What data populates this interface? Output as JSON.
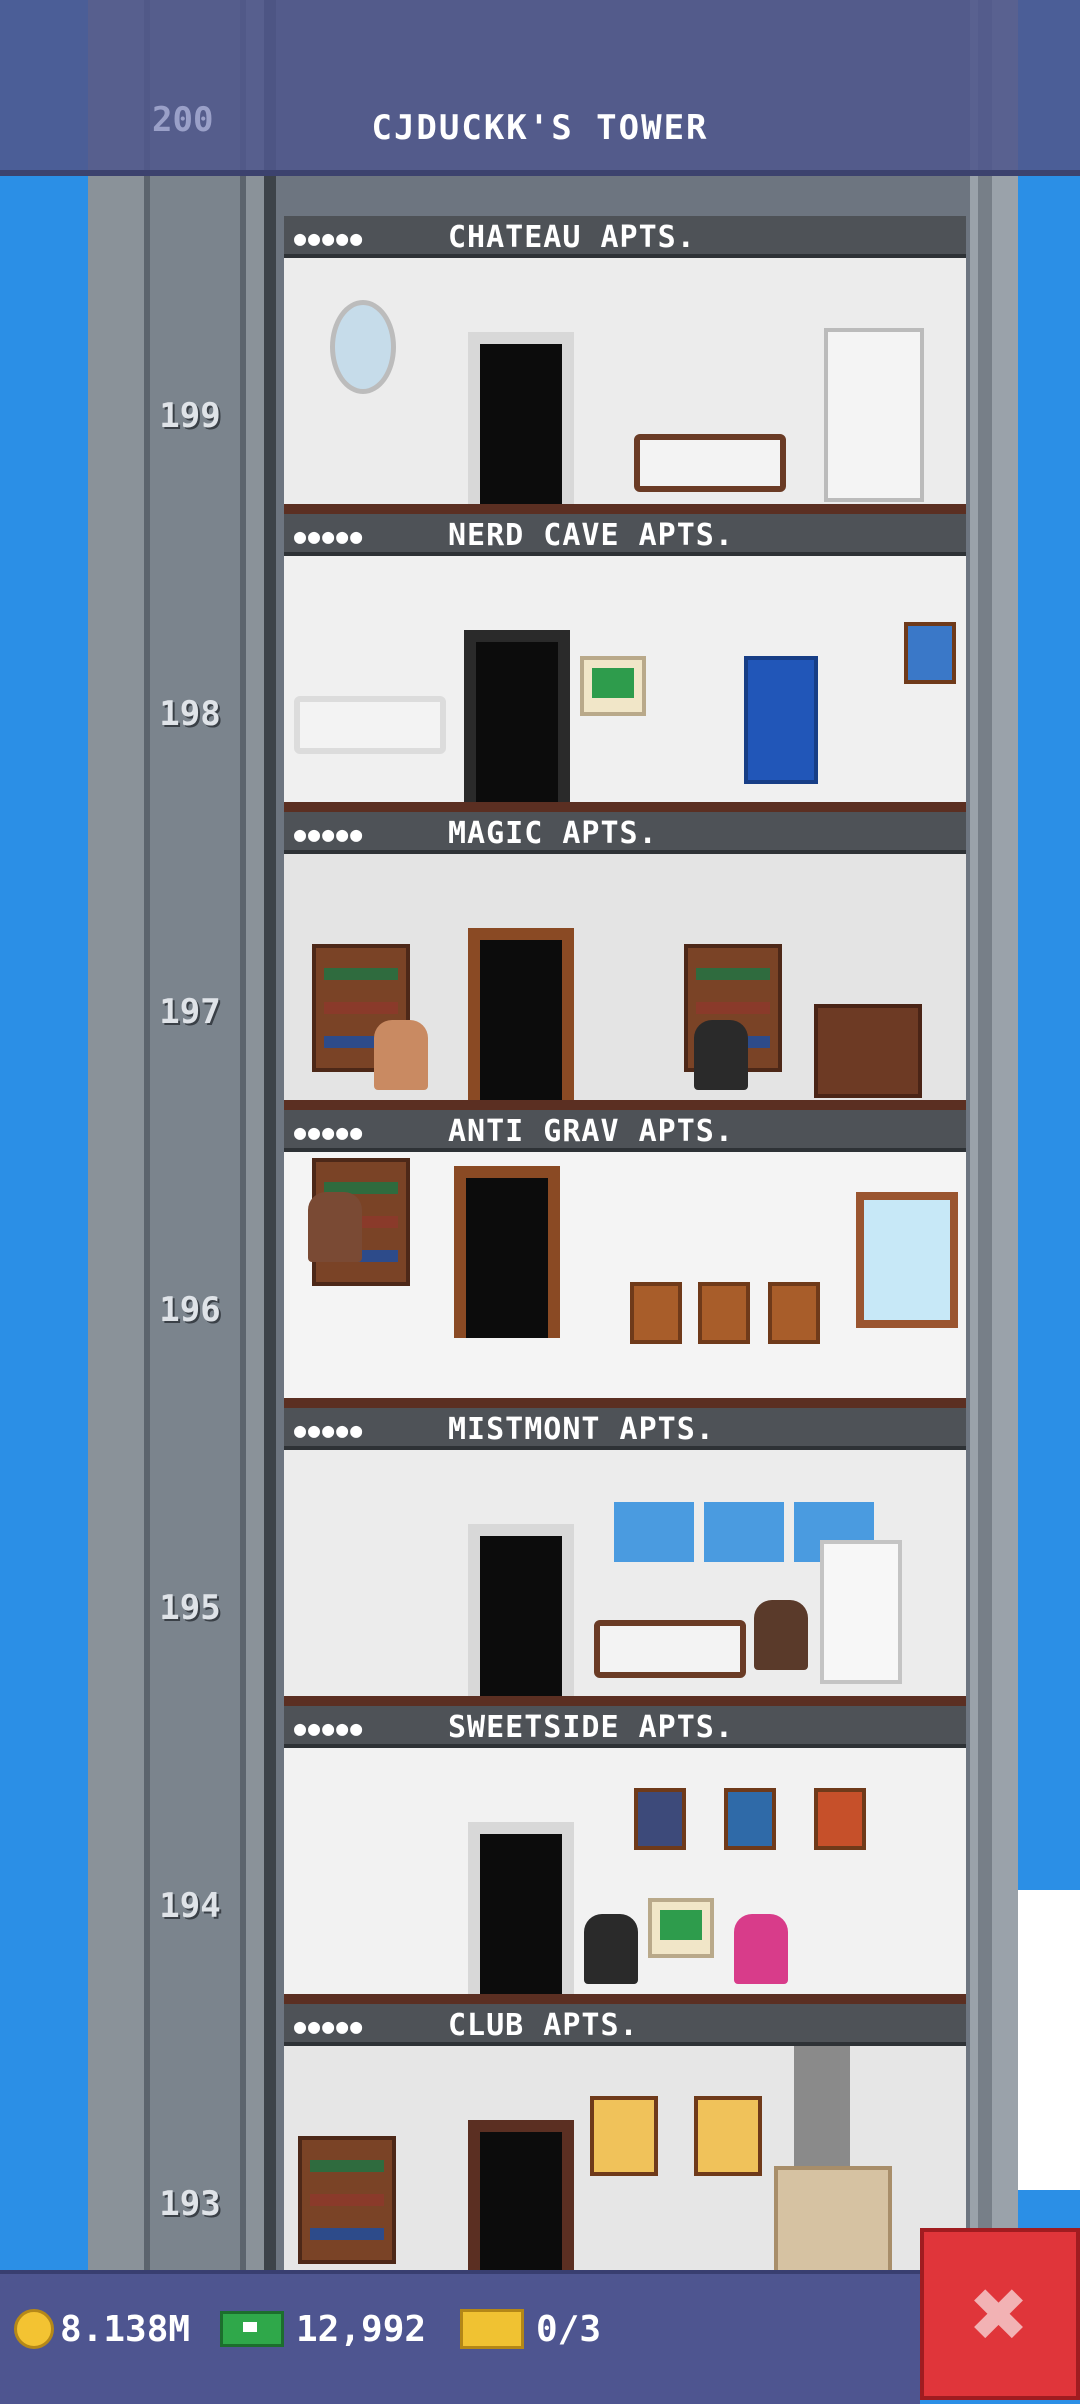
{
  "tower": {
    "title": "CJDUCKK'S TOWER",
    "top_floor_number": "200"
  },
  "floors": [
    {
      "number": "199",
      "name": "CHATEAU APTS.",
      "dots": "●●●●●"
    },
    {
      "number": "198",
      "name": "NERD CAVE APTS.",
      "dots": "●●●●●"
    },
    {
      "number": "197",
      "name": "MAGIC APTS.",
      "dots": "●●●●●"
    },
    {
      "number": "196",
      "name": "ANTI GRAV APTS.",
      "dots": "●●●●●"
    },
    {
      "number": "195",
      "name": "MISTMONT APTS.",
      "dots": "●●●●●"
    },
    {
      "number": "194",
      "name": "SWEETSIDE APTS.",
      "dots": "●●●●●"
    },
    {
      "number": "193",
      "name": "CLUB APTS.",
      "dots": "●●●●●"
    }
  ],
  "hud": {
    "coins": "8.138M",
    "bux": "12,992",
    "tickets": "0/3",
    "close_icon": "✖"
  },
  "colors": {
    "sky": "#2b8fe6",
    "hud": "#4e5590",
    "close": "#e0353a"
  }
}
